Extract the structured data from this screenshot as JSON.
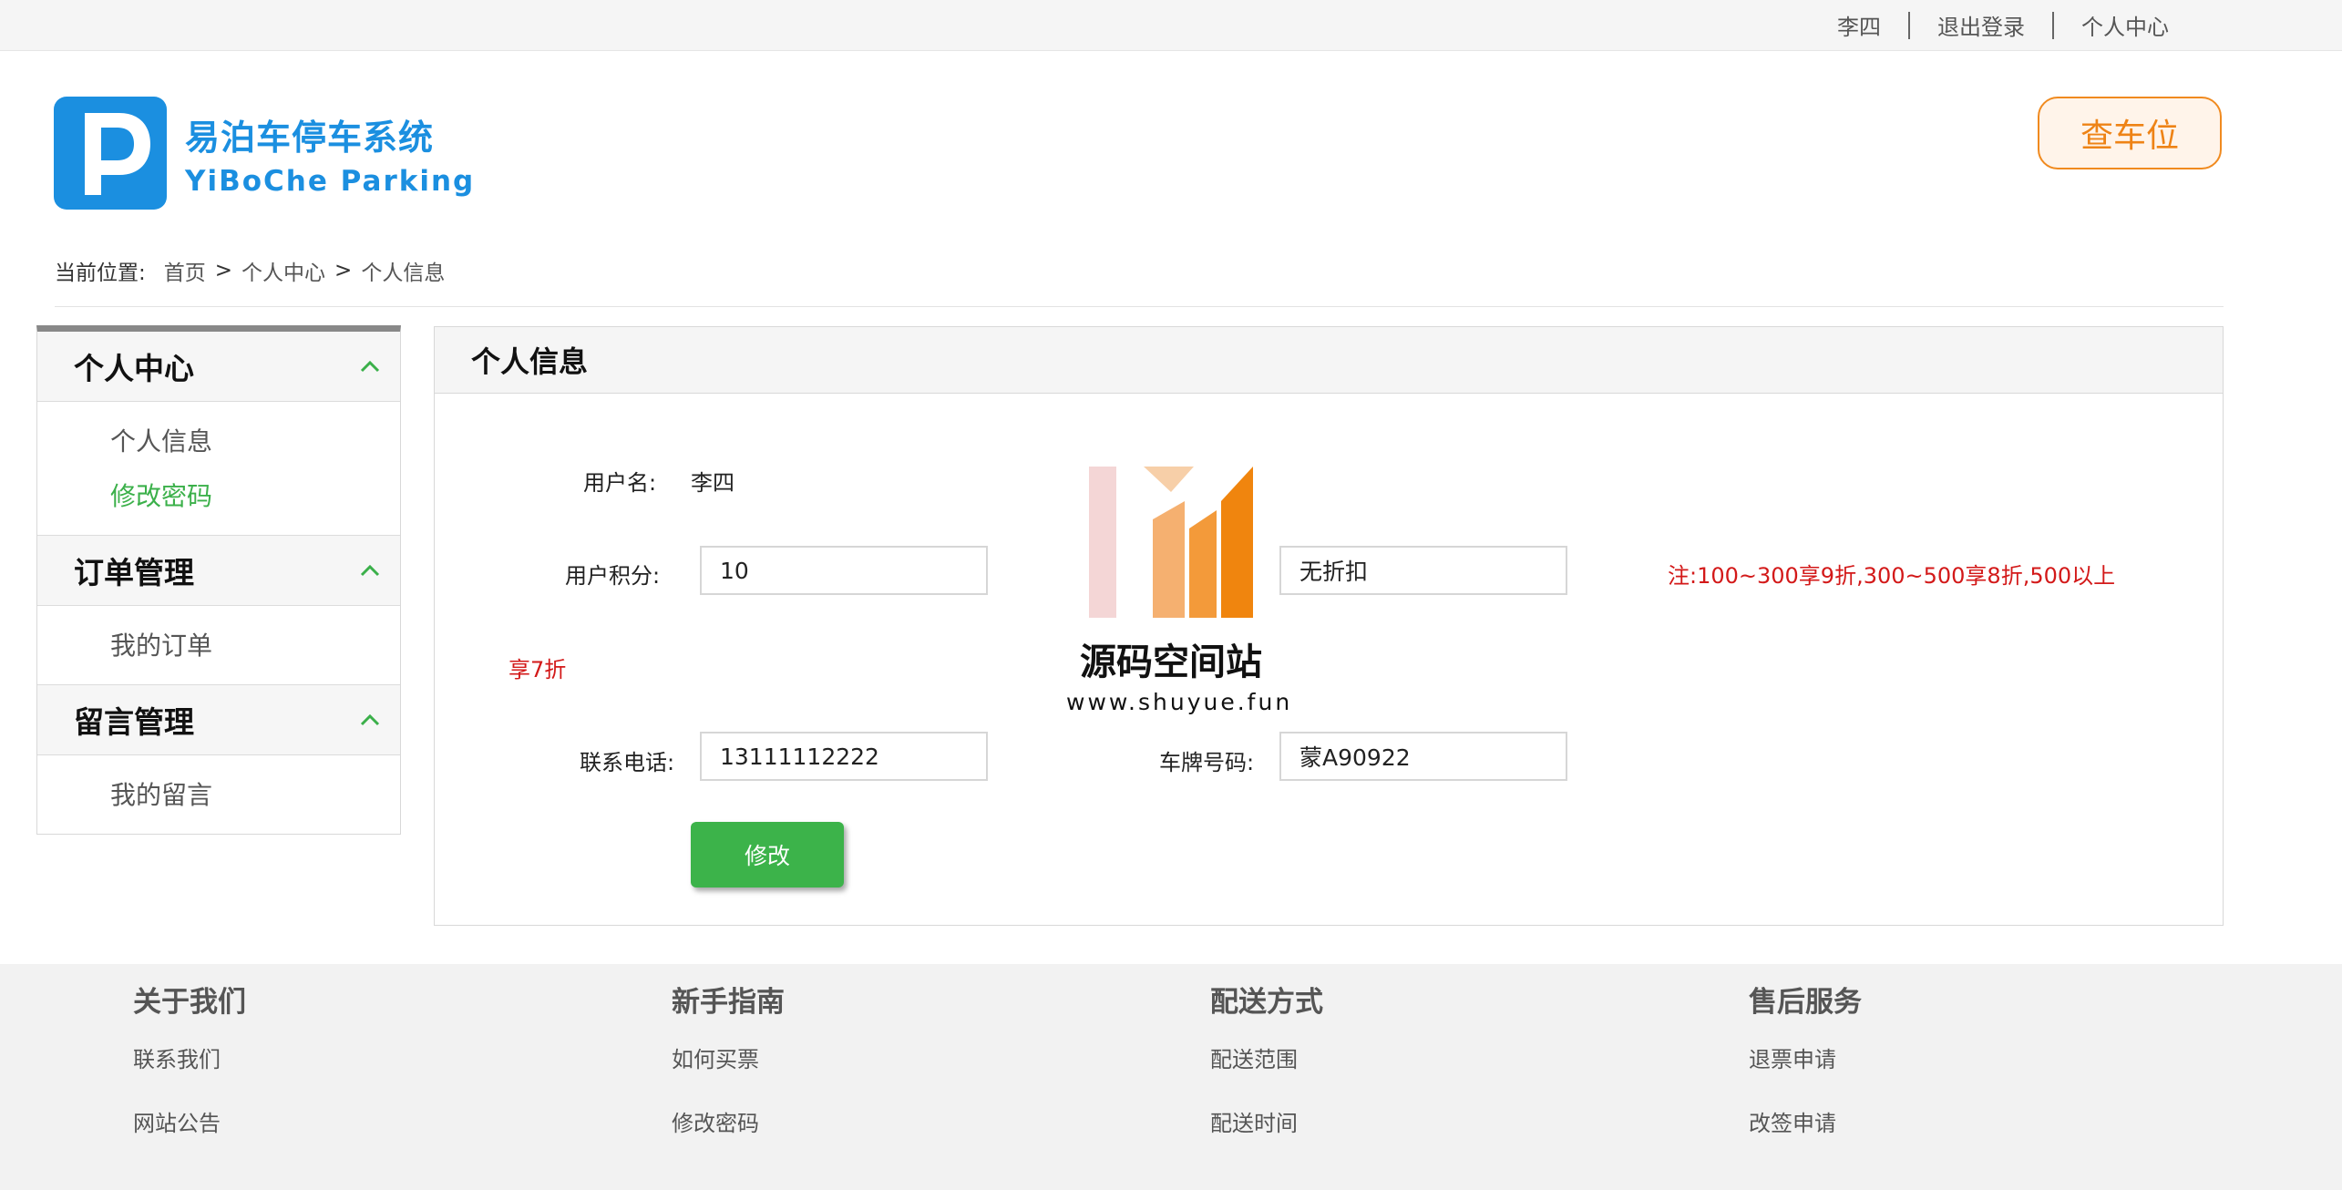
{
  "topbar": {
    "username": "李四",
    "logout": "退出登录",
    "personal_center": "个人中心"
  },
  "logo": {
    "letter": "P",
    "cn": "易泊车停车系统",
    "en": "YiBoChe  Parking"
  },
  "header": {
    "search_button": "查车位"
  },
  "breadcrumb": {
    "prefix": "当前位置:",
    "items": [
      "首页",
      "个人中心",
      "个人信息"
    ],
    "separator": ">"
  },
  "sidebar": {
    "groups": [
      {
        "title": "个人中心",
        "items": [
          "个人信息",
          "修改密码"
        ]
      },
      {
        "title": "订单管理",
        "items": [
          "我的订单"
        ]
      },
      {
        "title": "留言管理",
        "items": [
          "我的留言"
        ]
      }
    ],
    "active_item": "修改密码"
  },
  "panel": {
    "title": "个人信息",
    "username_label": "用户名:",
    "username_value": "李四",
    "points_label": "用户积分:",
    "points_value": "10",
    "discount_value": "无折扣",
    "note_main": "注:100~300享9折,300~500享8折,500以上",
    "note_wrap": "享7折",
    "phone_label": "联系电话:",
    "phone_value": "13111112222",
    "plate_label": "车牌号码:",
    "plate_value": "蒙A90922",
    "submit": "修改"
  },
  "watermark": {
    "title": "源码空间站",
    "url": "www.shuyue.fun"
  },
  "footer": {
    "columns": [
      {
        "title": "关于我们",
        "links": [
          "联系我们",
          "网站公告"
        ]
      },
      {
        "title": "新手指南",
        "links": [
          "如何买票",
          "修改密码"
        ]
      },
      {
        "title": "配送方式",
        "links": [
          "配送范围",
          "配送时间"
        ]
      },
      {
        "title": "售后服务",
        "links": [
          "退票申请",
          "改签申请"
        ]
      }
    ]
  },
  "colors": {
    "brand_blue": "#1b8fe0",
    "accent_orange": "#ee8316",
    "active_green": "#3bb04a",
    "note_red": "#d31919"
  }
}
